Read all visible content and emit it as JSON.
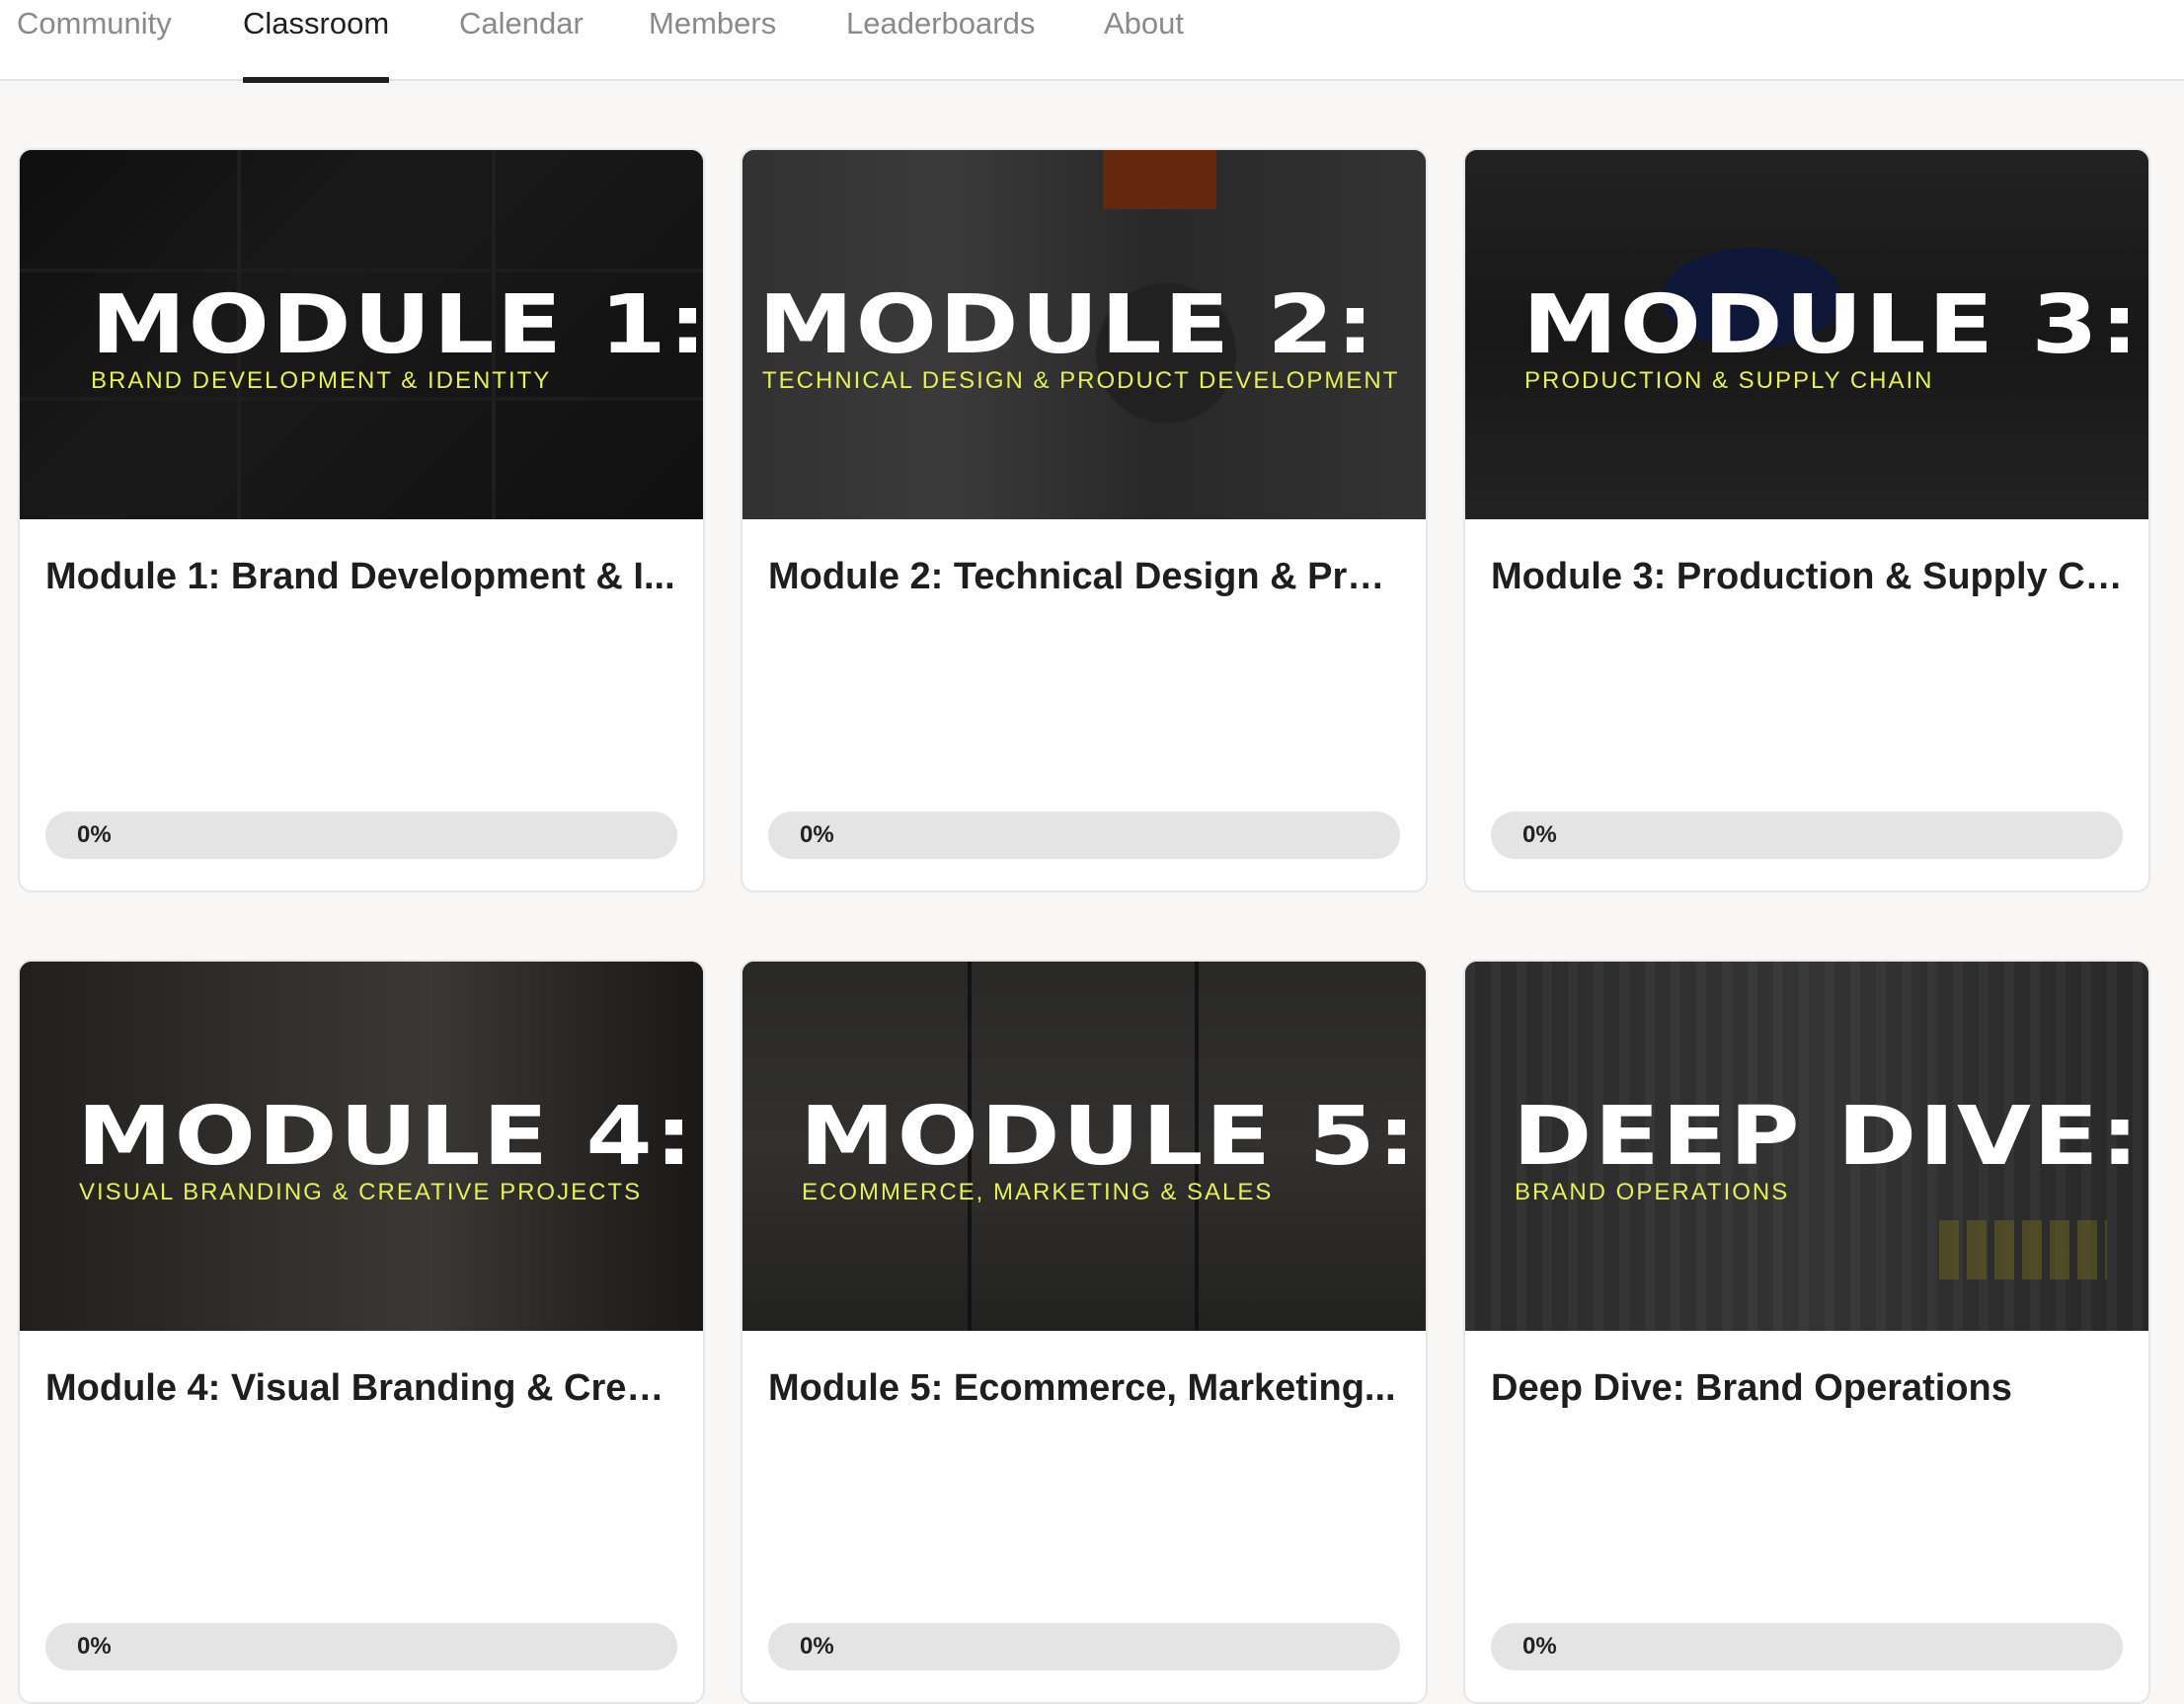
{
  "nav": {
    "tabs": [
      {
        "label": "Community",
        "active": false
      },
      {
        "label": "Classroom",
        "active": true
      },
      {
        "label": "Calendar",
        "active": false
      },
      {
        "label": "Members",
        "active": false
      },
      {
        "label": "Leaderboards",
        "active": false
      },
      {
        "label": "About",
        "active": false
      }
    ]
  },
  "courses": [
    {
      "cover_title": "MODULE 1:",
      "cover_subtitle": "BRAND DEVELOPMENT & IDENTITY",
      "title": "Module 1: Brand Development & I...",
      "progress_label": "0%",
      "progress": 0
    },
    {
      "cover_title": "MODULE 2:",
      "cover_subtitle": "TECHNICAL DESIGN & PRODUCT DEVELOPMENT",
      "title": "Module 2: Technical Design & Pro...",
      "progress_label": "0%",
      "progress": 0
    },
    {
      "cover_title": "MODULE 3:",
      "cover_subtitle": "PRODUCTION & SUPPLY CHAIN",
      "title": "Module 3: Production & Supply Ch...",
      "progress_label": "0%",
      "progress": 0
    },
    {
      "cover_title": "MODULE 4:",
      "cover_subtitle": "VISUAL BRANDING & CREATIVE PROJECTS",
      "title": "Module 4: Visual Branding & Crea...",
      "progress_label": "0%",
      "progress": 0
    },
    {
      "cover_title": "MODULE 5:",
      "cover_subtitle": "ECOMMERCE, MARKETING & SALES",
      "title": "Module 5: Ecommerce, Marketing...",
      "progress_label": "0%",
      "progress": 0
    },
    {
      "cover_title": "DEEP DIVE:",
      "cover_subtitle": "BRAND OPERATIONS",
      "title": "Deep Dive: Brand Operations",
      "progress_label": "0%",
      "progress": 0
    }
  ],
  "colors": {
    "accent_yellow": "#e5ef56",
    "progress_track": "#e4e4e4",
    "active_tab": "#1f1f1f",
    "inactive_tab": "#8a8a8a"
  }
}
